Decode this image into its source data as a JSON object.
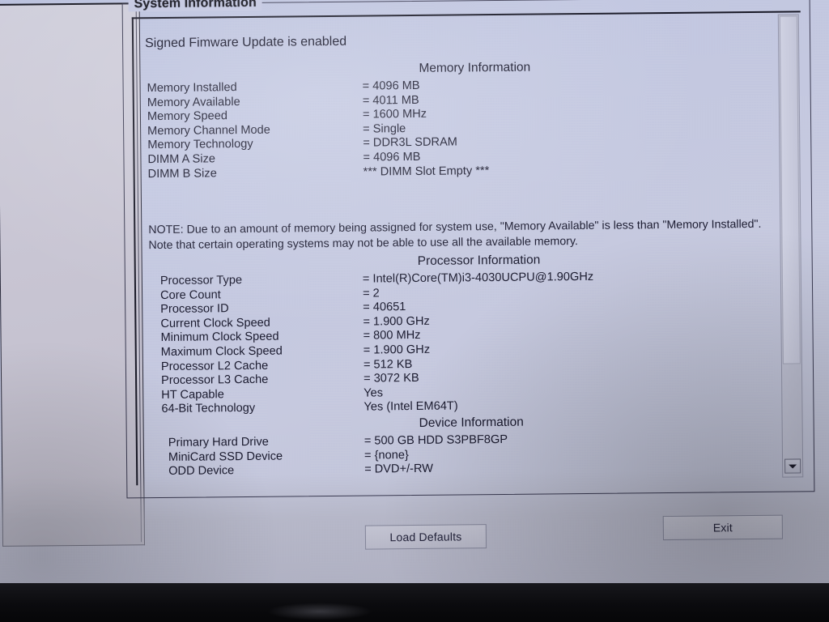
{
  "window": {
    "group_title": "System Information",
    "banner": "Signed Fimware Update is enabled"
  },
  "sections": [
    {
      "id": "memory",
      "title": "Memory Information",
      "rows": [
        {
          "label": "Memory Installed",
          "value": "= 4096 MB"
        },
        {
          "label": "Memory Available",
          "value": "= 4011 MB"
        },
        {
          "label": "Memory Speed",
          "value": "= 1600 MHz"
        },
        {
          "label": "Memory Channel Mode",
          "value": "= Single"
        },
        {
          "label": "Memory Technology",
          "value": "= DDR3L SDRAM"
        },
        {
          "label": "DIMM A Size",
          "value": "= 4096 MB"
        },
        {
          "label": "DIMM B Size",
          "value": "*** DIMM Slot Empty ***"
        }
      ]
    },
    {
      "id": "processor",
      "title": "Processor Information",
      "rows": [
        {
          "label": "Processor Type",
          "value": "= Intel(R)Core(TM)i3-4030UCPU@1.90GHz"
        },
        {
          "label": "Core Count",
          "value": "= 2"
        },
        {
          "label": "Processor ID",
          "value": "= 40651"
        },
        {
          "label": "Current Clock Speed",
          "value": "= 1.900 GHz"
        },
        {
          "label": "Minimum Clock Speed",
          "value": "= 800 MHz"
        },
        {
          "label": "Maximum Clock Speed",
          "value": "= 1.900 GHz"
        },
        {
          "label": "Processor L2 Cache",
          "value": "= 512 KB"
        },
        {
          "label": "Processor L3 Cache",
          "value": "= 3072 KB"
        },
        {
          "label": "HT Capable",
          "value": "Yes"
        },
        {
          "label": "64-Bit Technology",
          "value": "Yes (Intel EM64T)"
        }
      ]
    },
    {
      "id": "device",
      "title": "Device Information",
      "rows": [
        {
          "label": "Primary Hard Drive",
          "value": "= 500 GB HDD S3PBF8GP"
        },
        {
          "label": "MiniCard SSD Device",
          "value": "= {none}"
        },
        {
          "label": "ODD Device",
          "value": "= DVD+/-RW"
        }
      ]
    }
  ],
  "note": "NOTE: Due to an amount of memory being assigned for system use, \"Memory Available\" is less than \"Memory Installed\". Note that certain operating systems may not be able to use all the available memory.",
  "footer": {
    "load_defaults_label": "Load Defaults",
    "exit_label": "Exit"
  },
  "scrollbar": {
    "down_arrow": "down-arrow"
  },
  "colors": {
    "screen_background": "#c2c7e1",
    "text": "#1b1b30",
    "border": "#3b3b52",
    "lower_panel": "#aaaab6"
  }
}
